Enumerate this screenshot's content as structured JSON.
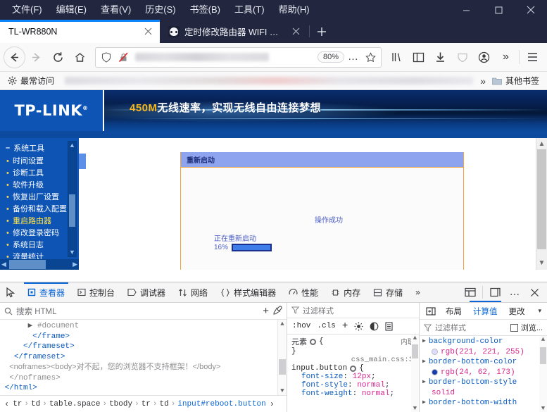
{
  "window": {
    "menus": [
      "文件(F)",
      "编辑(E)",
      "查看(V)",
      "历史(S)",
      "书签(B)",
      "工具(T)",
      "帮助(H)"
    ],
    "minimize_label": "最小化",
    "maximize_label": "最大化",
    "close_label": "关闭"
  },
  "tabs": {
    "items": [
      {
        "title": "TL-WR880N",
        "active": true,
        "close_label": "×"
      },
      {
        "title": "定时修改路由器 WIFI 密码",
        "active": false,
        "close_label": "×"
      }
    ],
    "new_tab_label": "+"
  },
  "toolbar": {
    "back_label": "←",
    "forward_label": "→",
    "reload_label": "⟳",
    "home_label": "⌂",
    "url_value": "",
    "url_placeholder": "",
    "zoom_level": "80%",
    "page_actions_label": "…",
    "bookmark_star_label": "☆",
    "library_label": "库",
    "sidebars_label": "侧边栏",
    "downloads_label": "下载",
    "pocket_label": "Pocket",
    "account_label": "账户",
    "overflow_label": "»",
    "appmenu_label": "≡"
  },
  "bookmarks": {
    "most_visited": "最常访问",
    "overflow_label": "»",
    "other_bookmarks": "其他书签"
  },
  "page": {
    "brand": "TP-LINK",
    "brand_mark": "®",
    "banner_highlight": "450M",
    "banner_text": "无线速率，实现无线自由连接梦想",
    "sidebar": {
      "group": "系统工具",
      "group_toggle": "–",
      "items": [
        {
          "label": "时间设置",
          "active": false
        },
        {
          "label": "诊断工具",
          "active": false
        },
        {
          "label": "软件升级",
          "active": false
        },
        {
          "label": "恢复出厂设置",
          "active": false
        },
        {
          "label": "备份和载入配置",
          "active": false
        },
        {
          "label": "重启路由器",
          "active": true
        },
        {
          "label": "修改登录密码",
          "active": false
        },
        {
          "label": "系统日志",
          "active": false
        },
        {
          "label": "流量统计",
          "active": false
        }
      ]
    },
    "panel": {
      "title": "重新启动",
      "success_text": "操作成功",
      "status_text": "正在重新启动",
      "progress_percent": "16%",
      "progress_value": 16
    }
  },
  "devtools": {
    "picker_label": "选取元素",
    "tabs": [
      {
        "label": "查看器",
        "icon": "inspector-icon",
        "active": true
      },
      {
        "label": "控制台",
        "icon": "console-icon",
        "active": false
      },
      {
        "label": "调试器",
        "icon": "debugger-icon",
        "active": false
      },
      {
        "label": "网络",
        "icon": "network-icon",
        "active": false
      },
      {
        "label": "样式编辑器",
        "icon": "style-editor-icon",
        "active": false
      },
      {
        "label": "性能",
        "icon": "performance-icon",
        "active": false
      },
      {
        "label": "内存",
        "icon": "memory-icon",
        "active": false
      },
      {
        "label": "存储",
        "icon": "storage-icon",
        "active": false
      }
    ],
    "tabs_overflow": "»",
    "responsive_label": "响应式设计模式",
    "separate_window_label": "独立窗口",
    "more_label": "…",
    "close_label": "×",
    "markup": {
      "search_placeholder": "搜索 HTML",
      "add_node_label": "+",
      "eyedropper_label": "取色器",
      "lines": [
        {
          "indent": 3,
          "text": "#document",
          "style": "gray",
          "twisty": true
        },
        {
          "indent": 3,
          "text": "</frame>",
          "style": "tag"
        },
        {
          "indent": 2,
          "text": "</frameset>",
          "style": "tag"
        },
        {
          "indent": 1,
          "text": "</frameset>",
          "style": "tag"
        },
        {
          "indent": 1,
          "text": "<noframes><body>对不起，您的浏览器不支持框架！</body>",
          "style": "gray"
        },
        {
          "indent": 1,
          "text": "</noframes>",
          "style": "gray"
        },
        {
          "indent": 0,
          "text": "</html>",
          "style": "tag"
        }
      ]
    },
    "breadcrumb": {
      "nodes": [
        "tr",
        "td",
        "table.space",
        "tbody",
        "tr",
        "td",
        "input#reboot.button"
      ],
      "selected_index": 6,
      "prev_label": "‹",
      "next_label": "›",
      "separator": "›"
    },
    "rules": {
      "filter_placeholder": "过滤样式",
      "hov_label": ":hov",
      "cls_label": ".cls",
      "add_rule_label": "+",
      "light_scheme_label": "浅色方案",
      "dark_scheme_label": "深色方案",
      "print_media_label": "打印样式",
      "element_rule": {
        "selector": "元素",
        "source": "内联",
        "open": "{",
        "close": "}"
      },
      "css_file": "css_main.css:3",
      "rule_selector": "input.button",
      "rule_open": "{",
      "declarations": [
        {
          "name": "font-size",
          "value": "12px"
        },
        {
          "name": "font-style",
          "value": "normal"
        },
        {
          "name": "font-weight",
          "value": "normal"
        }
      ]
    },
    "computed": {
      "tabs": [
        {
          "label": "布局",
          "active": false
        },
        {
          "label": "计算值",
          "active": true
        },
        {
          "label": "更改",
          "active": false
        }
      ],
      "expand_icon": "panel-toggle-icon",
      "caret_label": "▾",
      "filter_placeholder": "过滤样式",
      "browser_styles_label": "浏览...",
      "properties": [
        {
          "name": "background-color",
          "value": "rgb(221, 221, 255)",
          "swatch": "#ddddff"
        },
        {
          "name": "border-bottom-color",
          "value": "rgb(24, 62, 173)",
          "swatch": "#183ead"
        },
        {
          "name": "border-bottom-style",
          "value": "solid",
          "swatch": null
        },
        {
          "name": "border-bottom-width",
          "value": "",
          "swatch": null
        }
      ]
    }
  },
  "colors": {
    "titlebar": "#22273f",
    "accent": "#0a84ff",
    "router_blue": "#0d54b5",
    "panel_border": "#f0a33a",
    "panel_header": "#8fa4ef",
    "highlight_yellow": "#ffe14a"
  }
}
